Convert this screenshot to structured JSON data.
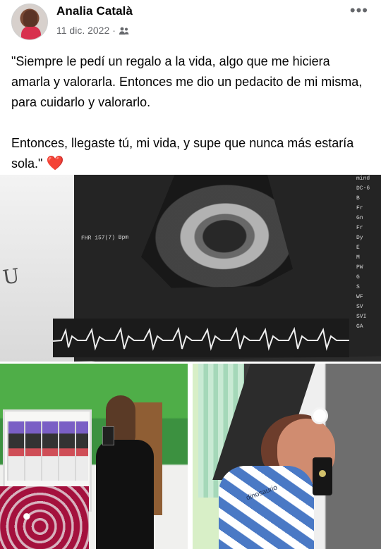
{
  "author": {
    "name": "Analia Català",
    "date": "11 dic. 2022",
    "audience_icon": "friends-icon"
  },
  "post": {
    "paragraph_1": "\"Siempre le pedí un regalo a la vida, algo que me hiciera amarla y valorarla. Entonces me dio un pedacito de mi misma, para cuidarlo y valorarlo.",
    "paragraph_2": "Entonces, llegaste tú, mi vida, y supe que nunca más estaría sola.\"",
    "emoji": "❤️"
  },
  "photos": {
    "ultrasound": {
      "left_label": "FHR  157(7) Bpm",
      "side_labels": [
        "mind",
        "DC-6",
        "B",
        "Fr",
        "Gn",
        "Fr",
        "Dy",
        "E",
        "M",
        "PW",
        "G",
        "S",
        "WF",
        "SV",
        "SVI",
        "GA"
      ]
    },
    "selfie_shirt_text": "dinosaurio"
  },
  "icons": {
    "more": "more-options-icon",
    "heart": "heart-emoji-icon"
  }
}
